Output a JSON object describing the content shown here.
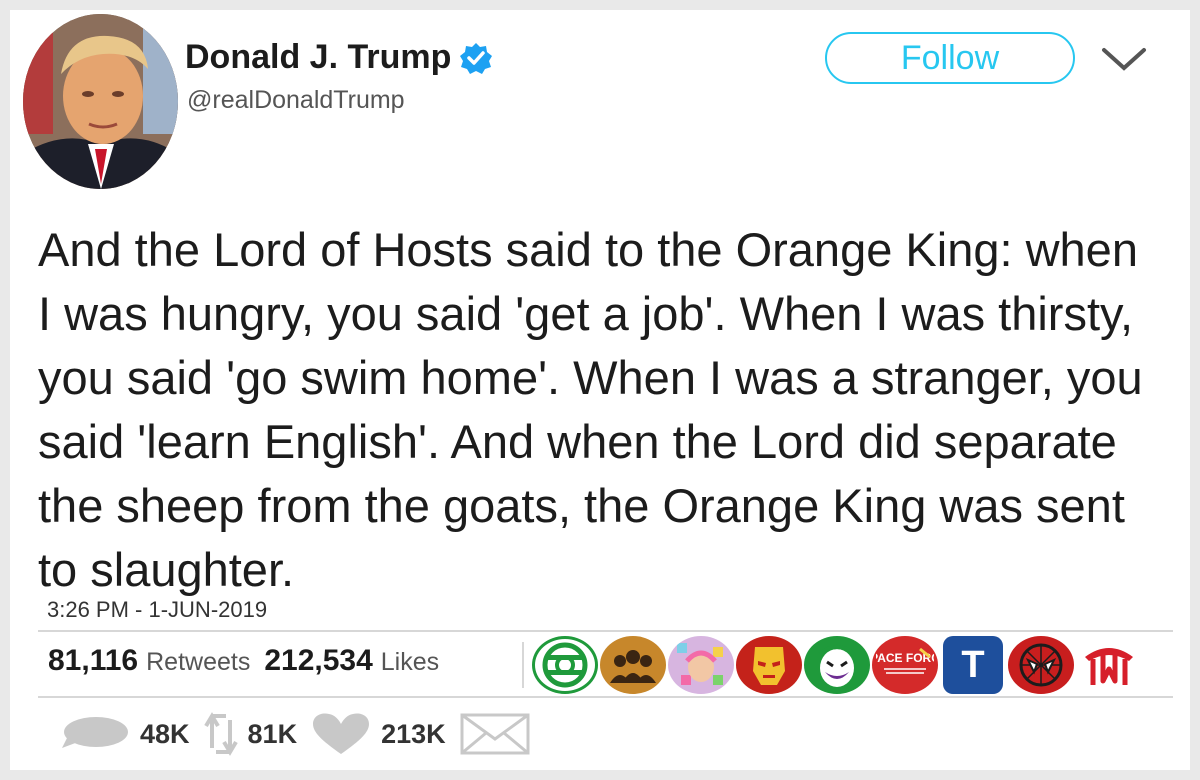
{
  "user": {
    "display_name": "Donald J. Trump",
    "handle": "@realDonaldTrump",
    "verified": true
  },
  "follow_label": "Follow",
  "tweet": {
    "text": "And the Lord of Hosts said to the Orange King: when I was hungry, you said 'get a job'. When I was thirsty, you said 'go swim home'. When I was a stranger, you said 'learn English'. And when the Lord did separate the sheep from the goats, the Orange King was sent to slaughter.",
    "timestamp": "3:26 PM - 1-JUN-2019"
  },
  "stats": {
    "retweets_count": "81,116",
    "retweets_label": "Retweets",
    "likes_count": "212,534",
    "likes_label": "Likes"
  },
  "liker_avatars": [
    {
      "icon": "green-lantern-icon",
      "color": "#1f9a3b"
    },
    {
      "icon": "group-silhouette-icon",
      "color": "#c7872b"
    },
    {
      "icon": "sparkle-face-icon",
      "color": "#d7b5e0"
    },
    {
      "icon": "iron-man-icon",
      "color": "#c4221a"
    },
    {
      "icon": "joker-icon",
      "color": "#1f9a3b"
    },
    {
      "icon": "space-force-icon",
      "color": "#d42a2a",
      "label": "SPACE FORCE"
    },
    {
      "icon": "letter-t-icon",
      "color": "#1e4f9c",
      "label": "T"
    },
    {
      "icon": "spiderman-icon",
      "color": "#c81e1e"
    },
    {
      "icon": "m-logo-icon",
      "color": "#d61f2a"
    }
  ],
  "actions": {
    "reply_count": "48K",
    "retweet_count": "81K",
    "like_count": "213K"
  },
  "colors": {
    "follow_accent": "#27c7f0",
    "verified_blue": "#1da1f2",
    "action_grey": "#c8c8c8"
  }
}
